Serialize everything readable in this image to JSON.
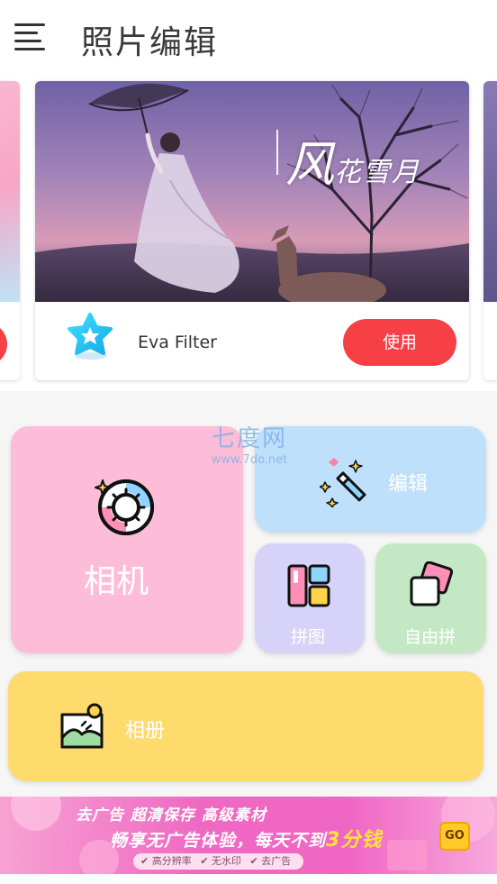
{
  "header": {
    "title": "照片编辑"
  },
  "featured": {
    "caption_big": "风",
    "caption_small": "花雪月",
    "filter_name": "Eva Filter",
    "use_label": "使用"
  },
  "watermark": {
    "big": "七度网",
    "small": "www.7do.net"
  },
  "tiles": {
    "camera": "相机",
    "edit": "编辑",
    "collage": "拼图",
    "free_collage": "自由拼",
    "album": "相册"
  },
  "ad": {
    "line1": "去广告 超清保存 高级素材",
    "line2_prefix": "畅享无广告体验，每天不到",
    "line2_highlight": "3分钱",
    "tags": [
      "✔ 高分辨率",
      "✔ 无水印",
      "✔ 去广告"
    ],
    "go_label": "GO"
  },
  "colors": {
    "accent_red": "#f74046",
    "camera_tile": "#fdbdd9",
    "edit_tile": "#bfe0fb",
    "collage_tile": "#d7d3f8",
    "free_tile": "#c4e8c4",
    "album_tile": "#ffdb6e"
  },
  "icons": {
    "menu": "hamburger-menu-icon",
    "filter": "star-badge-icon",
    "camera": "camera-lens-icon",
    "edit": "magic-wand-icon",
    "collage": "layout-grid-icon",
    "free": "stacked-photos-icon",
    "album": "landscape-photo-icon"
  }
}
